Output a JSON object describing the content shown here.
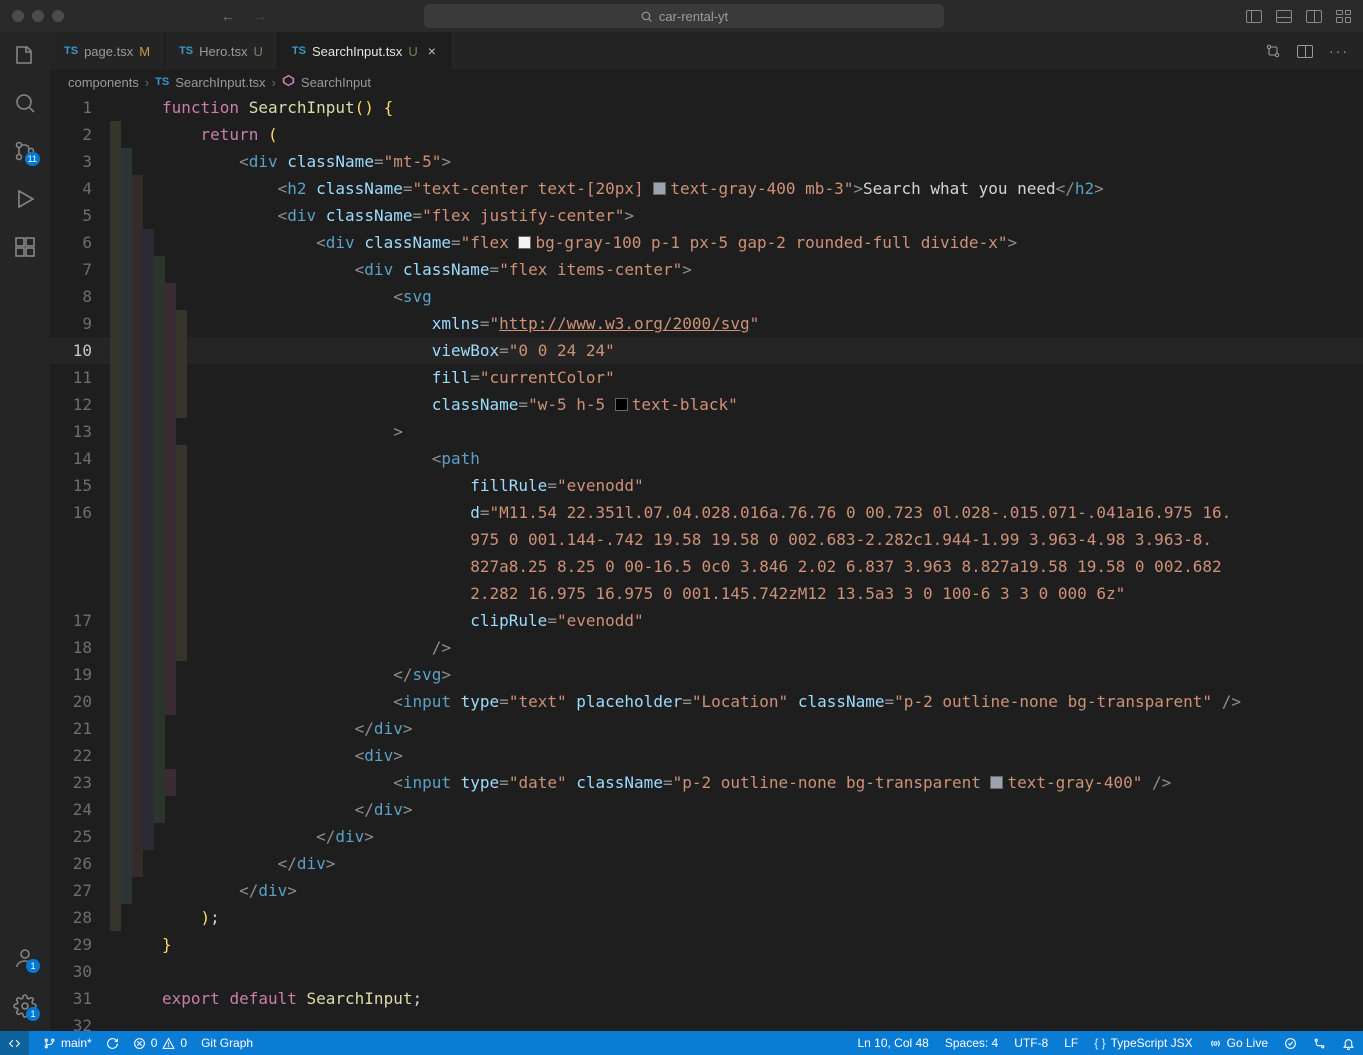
{
  "title": {
    "search_text": "car-rental-yt"
  },
  "activity": {
    "scm_badge": "11",
    "account_badge": "1",
    "settings_badge": "1"
  },
  "tabs": [
    {
      "icon": "TS",
      "name": "page.tsx",
      "status": "M",
      "status_class": "mod",
      "active": false,
      "close": false
    },
    {
      "icon": "TS",
      "name": "Hero.tsx",
      "status": "U",
      "status_class": "unt",
      "active": false,
      "close": false
    },
    {
      "icon": "TS",
      "name": "SearchInput.tsx",
      "status": "U",
      "status_class": "unt",
      "active": true,
      "close": true
    }
  ],
  "breadcrumb": {
    "seg1": "components",
    "seg2_icon": "TS",
    "seg2": "SearchInput.tsx",
    "seg3": "SearchInput"
  },
  "code": {
    "l1": {
      "tokens": [
        [
          "kw",
          "function "
        ],
        [
          "fn",
          "SearchInput"
        ],
        [
          "pn",
          "()"
        ],
        [
          "txt",
          " "
        ],
        [
          "pn",
          "{"
        ]
      ]
    },
    "l2": {
      "pad": 1,
      "tokens": [
        [
          "kw",
          "return"
        ],
        [
          "txt",
          " "
        ],
        [
          "pn",
          "("
        ]
      ]
    },
    "l3": {
      "pad": 2,
      "tokens": [
        [
          "br",
          "<"
        ],
        [
          "tag",
          "div"
        ],
        [
          "txt",
          " "
        ],
        [
          "attr",
          "className"
        ],
        [
          "br",
          "="
        ],
        [
          "str",
          "\"mt-5\""
        ],
        [
          "br",
          ">"
        ]
      ]
    },
    "l4": {
      "pad": 3,
      "tokens": [
        [
          "br",
          "<"
        ],
        [
          "tag",
          "h2"
        ],
        [
          "txt",
          " "
        ],
        [
          "attr",
          "className"
        ],
        [
          "br",
          "="
        ],
        [
          "str",
          "\"text-center text-[20px] "
        ],
        [
          "sw",
          "gray"
        ],
        [
          "str",
          "text-gray-400 mb-3\""
        ],
        [
          "br",
          ">"
        ],
        [
          "txt",
          "Search what you need"
        ],
        [
          "br",
          "</"
        ],
        [
          "tag",
          "h2"
        ],
        [
          "br",
          ">"
        ]
      ]
    },
    "l5": {
      "pad": 3,
      "tokens": [
        [
          "br",
          "<"
        ],
        [
          "tag",
          "div"
        ],
        [
          "txt",
          " "
        ],
        [
          "attr",
          "className"
        ],
        [
          "br",
          "="
        ],
        [
          "str",
          "\"flex justify-center\""
        ],
        [
          "br",
          ">"
        ]
      ]
    },
    "l6": {
      "pad": 4,
      "tokens": [
        [
          "br",
          "<"
        ],
        [
          "tag",
          "div"
        ],
        [
          "txt",
          " "
        ],
        [
          "attr",
          "className"
        ],
        [
          "br",
          "="
        ],
        [
          "str",
          "\"flex "
        ],
        [
          "sw",
          "white"
        ],
        [
          "str",
          "bg-gray-100 p-1 px-5 gap-2 rounded-full divide-x\""
        ],
        [
          "br",
          ">"
        ]
      ]
    },
    "l7": {
      "pad": 5,
      "tokens": [
        [
          "br",
          "<"
        ],
        [
          "tag",
          "div"
        ],
        [
          "txt",
          " "
        ],
        [
          "attr",
          "className"
        ],
        [
          "br",
          "="
        ],
        [
          "str",
          "\"flex items-center\""
        ],
        [
          "br",
          ">"
        ]
      ]
    },
    "l8": {
      "pad": 6,
      "tokens": [
        [
          "br",
          "<"
        ],
        [
          "tag",
          "svg"
        ]
      ]
    },
    "l9": {
      "pad": 7,
      "tokens": [
        [
          "attr",
          "xmlns"
        ],
        [
          "br",
          "="
        ],
        [
          "str",
          "\""
        ],
        [
          "link",
          "http://www.w3.org/2000/svg"
        ],
        [
          "str",
          "\""
        ]
      ]
    },
    "l10": {
      "pad": 7,
      "tokens": [
        [
          "attr",
          "viewBox"
        ],
        [
          "br",
          "="
        ],
        [
          "str",
          "\"0 0 24 24\""
        ]
      ]
    },
    "l11": {
      "pad": 7,
      "tokens": [
        [
          "attr",
          "fill"
        ],
        [
          "br",
          "="
        ],
        [
          "str",
          "\"currentColor\""
        ]
      ]
    },
    "l12": {
      "pad": 7,
      "tokens": [
        [
          "attr",
          "className"
        ],
        [
          "br",
          "="
        ],
        [
          "str",
          "\"w-5 h-5 "
        ],
        [
          "sw",
          "black"
        ],
        [
          "str",
          "text-black\""
        ]
      ]
    },
    "l13": {
      "pad": 6,
      "tokens": [
        [
          "br",
          ">"
        ]
      ]
    },
    "l14": {
      "pad": 7,
      "tokens": [
        [
          "br",
          "<"
        ],
        [
          "tag",
          "path"
        ]
      ]
    },
    "l15": {
      "pad": 8,
      "tokens": [
        [
          "attr",
          "fillRule"
        ],
        [
          "br",
          "="
        ],
        [
          "str",
          "\"evenodd\""
        ]
      ]
    },
    "l16": {
      "pad": 8,
      "tokens": [
        [
          "attr",
          "d"
        ],
        [
          "br",
          "="
        ],
        [
          "str",
          "\"M11.54 22.351l.07.04.028.016a.76.76 0 00.723 0l.028-.015.071-.041a16.975 16."
        ]
      ]
    },
    "l16b": {
      "pad": 8,
      "tokens": [
        [
          "str",
          "975 0 001.144-.742 19.58 19.58 0 002.683-2.282c1.944-1.99 3.963-4.98 3.963-8."
        ]
      ]
    },
    "l16c": {
      "pad": 8,
      "tokens": [
        [
          "str",
          "827a8.25 8.25 0 00-16.5 0c0 3.846 2.02 6.837 3.963 8.827a19.58 19.58 0 002.682 "
        ]
      ]
    },
    "l16d": {
      "pad": 8,
      "tokens": [
        [
          "str",
          "2.282 16.975 16.975 0 001.145.742zM12 13.5a3 3 0 100-6 3 3 0 000 6z\""
        ]
      ]
    },
    "l17": {
      "pad": 8,
      "tokens": [
        [
          "attr",
          "clipRule"
        ],
        [
          "br",
          "="
        ],
        [
          "str",
          "\"evenodd\""
        ]
      ]
    },
    "l18": {
      "pad": 7,
      "tokens": [
        [
          "br",
          "/>"
        ]
      ]
    },
    "l19": {
      "pad": 6,
      "tokens": [
        [
          "br",
          "</"
        ],
        [
          "tag",
          "svg"
        ],
        [
          "br",
          ">"
        ]
      ]
    },
    "l20": {
      "pad": 6,
      "tokens": [
        [
          "br",
          "<"
        ],
        [
          "tag",
          "input"
        ],
        [
          "txt",
          " "
        ],
        [
          "attr",
          "type"
        ],
        [
          "br",
          "="
        ],
        [
          "str",
          "\"text\""
        ],
        [
          "txt",
          " "
        ],
        [
          "attr",
          "placeholder"
        ],
        [
          "br",
          "="
        ],
        [
          "str",
          "\"Location\""
        ],
        [
          "txt",
          " "
        ],
        [
          "attr",
          "className"
        ],
        [
          "br",
          "="
        ],
        [
          "str",
          "\"p-2 outline-none bg-transparent\""
        ],
        [
          "txt",
          " "
        ],
        [
          "br",
          "/>"
        ]
      ]
    },
    "l21": {
      "pad": 5,
      "tokens": [
        [
          "br",
          "</"
        ],
        [
          "tag",
          "div"
        ],
        [
          "br",
          ">"
        ]
      ]
    },
    "l22": {
      "pad": 5,
      "tokens": [
        [
          "br",
          "<"
        ],
        [
          "tag",
          "div"
        ],
        [
          "br",
          ">"
        ]
      ]
    },
    "l23": {
      "pad": 6,
      "tokens": [
        [
          "br",
          "<"
        ],
        [
          "tag",
          "input"
        ],
        [
          "txt",
          " "
        ],
        [
          "attr",
          "type"
        ],
        [
          "br",
          "="
        ],
        [
          "str",
          "\"date\""
        ],
        [
          "txt",
          " "
        ],
        [
          "attr",
          "className"
        ],
        [
          "br",
          "="
        ],
        [
          "str",
          "\"p-2 outline-none bg-transparent "
        ],
        [
          "sw",
          "gray"
        ],
        [
          "str",
          "text-gray-400\""
        ],
        [
          "txt",
          " "
        ],
        [
          "br",
          "/>"
        ]
      ]
    },
    "l24": {
      "pad": 5,
      "tokens": [
        [
          "br",
          "</"
        ],
        [
          "tag",
          "div"
        ],
        [
          "br",
          ">"
        ]
      ]
    },
    "l25": {
      "pad": 4,
      "tokens": [
        [
          "br",
          "</"
        ],
        [
          "tag",
          "div"
        ],
        [
          "br",
          ">"
        ]
      ]
    },
    "l26": {
      "pad": 3,
      "tokens": [
        [
          "br",
          "</"
        ],
        [
          "tag",
          "div"
        ],
        [
          "br",
          ">"
        ]
      ]
    },
    "l27": {
      "pad": 2,
      "tokens": [
        [
          "br",
          "</"
        ],
        [
          "tag",
          "div"
        ],
        [
          "br",
          ">"
        ]
      ]
    },
    "l28": {
      "pad": 1,
      "tokens": [
        [
          "pn",
          ")"
        ],
        [
          "txt",
          ";"
        ]
      ]
    },
    "l29": {
      "tokens": [
        [
          "pn",
          "}"
        ]
      ]
    },
    "l30": {
      "tokens": []
    },
    "l31": {
      "tokens": [
        [
          "kw",
          "export "
        ],
        [
          "kw",
          "default "
        ],
        [
          "fn",
          "SearchInput"
        ],
        [
          "txt",
          ";"
        ]
      ]
    },
    "l32": {
      "tokens": []
    }
  },
  "lines": [
    [
      "1",
      "l1"
    ],
    [
      "2",
      "l2"
    ],
    [
      "3",
      "l3"
    ],
    [
      "4",
      "l4"
    ],
    [
      "5",
      "l5"
    ],
    [
      "6",
      "l6"
    ],
    [
      "7",
      "l7"
    ],
    [
      "8",
      "l8"
    ],
    [
      "9",
      "l9"
    ],
    [
      "10",
      "l10"
    ],
    [
      "11",
      "l11"
    ],
    [
      "12",
      "l12"
    ],
    [
      "13",
      "l13"
    ],
    [
      "14",
      "l14"
    ],
    [
      "15",
      "l15"
    ],
    [
      "16",
      "l16"
    ],
    [
      "",
      "l16b"
    ],
    [
      "",
      "l16c"
    ],
    [
      "",
      "l16d"
    ],
    [
      "17",
      "l17"
    ],
    [
      "18",
      "l18"
    ],
    [
      "19",
      "l19"
    ],
    [
      "20",
      "l20"
    ],
    [
      "21",
      "l21"
    ],
    [
      "22",
      "l22"
    ],
    [
      "23",
      "l23"
    ],
    [
      "24",
      "l24"
    ],
    [
      "25",
      "l25"
    ],
    [
      "26",
      "l26"
    ],
    [
      "27",
      "l27"
    ],
    [
      "28",
      "l28"
    ],
    [
      "29",
      "l29"
    ],
    [
      "30",
      "l30"
    ],
    [
      "31",
      "l31"
    ],
    [
      "32",
      "l32"
    ]
  ],
  "status": {
    "branch": "main*",
    "errors": "0",
    "warnings": "0",
    "git_graph": "Git Graph",
    "cursor": "Ln 10, Col 48",
    "spaces": "Spaces: 4",
    "encoding": "UTF-8",
    "eol": "LF",
    "lang": "TypeScript JSX",
    "golive": "Go Live"
  }
}
